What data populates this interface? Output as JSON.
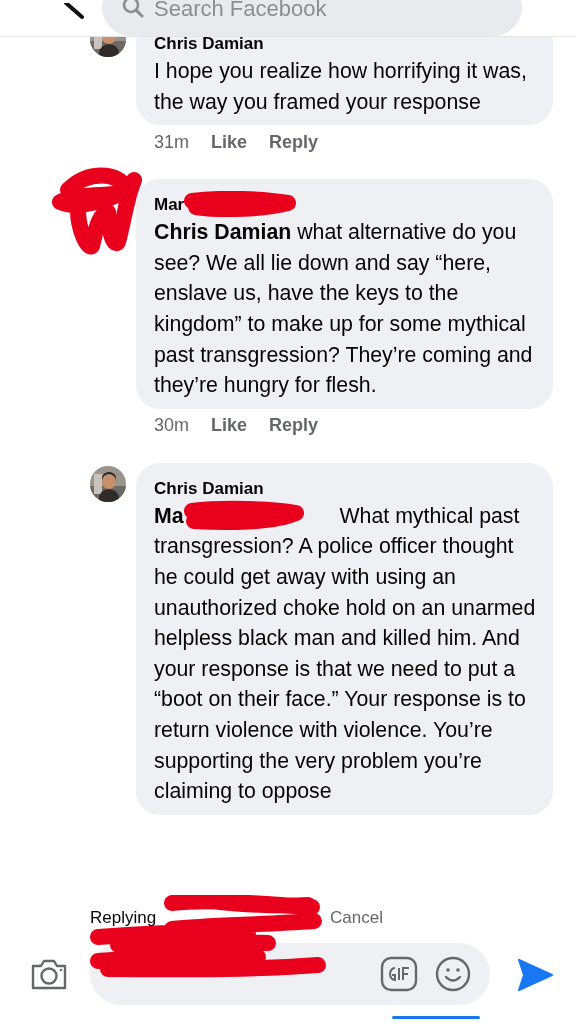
{
  "header": {
    "search": {
      "placeholder": "Search Facebook"
    }
  },
  "comments": [
    {
      "author": "Chris Damian",
      "author_redacted": false,
      "avatar_redacted": false,
      "mention_redacted": false,
      "text": "I hope you realize how horrifying it was, the way you framed your response",
      "time": "31m",
      "like": "Like",
      "reply": "Reply"
    },
    {
      "author": "Mar",
      "author_redacted": true,
      "avatar_redacted": true,
      "mention": "Chris Damian",
      "mention_redacted": false,
      "text": "what alternative do you see? We all lie down and say “here, enslave us, have the keys to the kingdom” to make up for some mythical past transgression? They’re coming and they’re hungry for flesh.",
      "time": "30m",
      "like": "Like",
      "reply": "Reply"
    },
    {
      "author": "Chris Damian",
      "author_redacted": false,
      "avatar_redacted": false,
      "mention": "Ma",
      "mention_redacted": true,
      "text": "What mythical past transgression? A police officer thought he could get away with using an unauthorized choke hold on an unarmed helpless black man and killed him. And your response is that we need to put a “boot on their face.” Your response is to return violence with violence. You’re supporting the very problem you’re claiming to oppose"
    }
  ],
  "composer": {
    "replying": "Replying",
    "cancel": "Cancel",
    "redacted": true
  }
}
